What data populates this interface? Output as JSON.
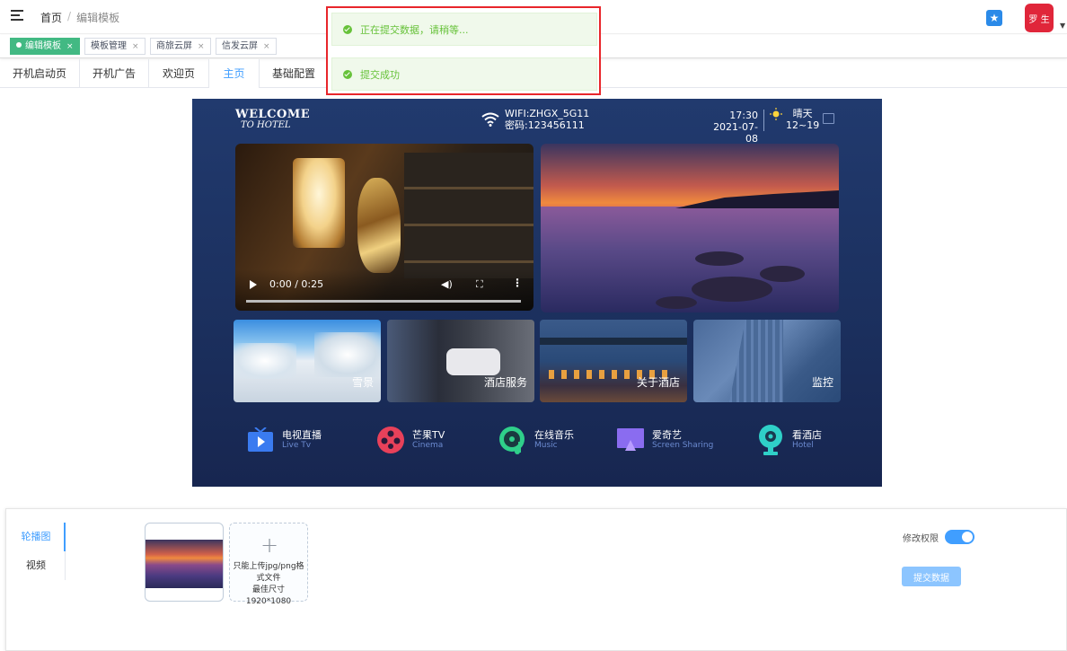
{
  "header": {
    "breadcrumb_home": "首页",
    "breadcrumb_sep": "/",
    "breadcrumb_current": "编辑模板",
    "avatar_text": "罗 生"
  },
  "tags": [
    {
      "label": "编辑模板",
      "active": true
    },
    {
      "label": "模板管理",
      "active": false
    },
    {
      "label": "商旅云屏",
      "active": false
    },
    {
      "label": "信发云屏",
      "active": false
    }
  ],
  "tag_close": "×",
  "page_tabs": [
    "开机启动页",
    "开机广告",
    "欢迎页",
    "主页",
    "基础配置"
  ],
  "active_page_tab": "主页",
  "notifications": [
    {
      "text": "正在提交数据，请稍等..."
    },
    {
      "text": "提交成功"
    }
  ],
  "preview": {
    "welcome_line1": "WELCOME",
    "welcome_line2": "TO HOTEL",
    "wifi_name": "WIFI:ZHGX_5G11",
    "wifi_password": "密码:123456111",
    "time": "17:30",
    "date": "2021-07-08",
    "weather": "晴天",
    "temperature": "12~19",
    "video_time": "0:00 / 0:25",
    "video_progress": 0,
    "tiles": [
      "雪景",
      "酒店服务",
      "关于酒店",
      "监控"
    ],
    "apps": [
      {
        "name": "电视直播",
        "sub": "Live Tv",
        "icon": "tv-icon",
        "color": "#3a7bf0"
      },
      {
        "name": "芒果TV",
        "sub": "Cinema",
        "icon": "film-reel-icon",
        "color": "#e8415a"
      },
      {
        "name": "在线音乐",
        "sub": "Music",
        "icon": "music-disc-icon",
        "color": "#2fcf8a"
      },
      {
        "name": "爱奇艺",
        "sub": "Screen Sharing",
        "icon": "screen-share-icon",
        "color": "#8a6cf0"
      },
      {
        "name": "看酒店",
        "sub": "Hotel",
        "icon": "camera-icon",
        "color": "#2fd0c8"
      }
    ]
  },
  "bottom": {
    "side_tabs": [
      "轮播图",
      "视频"
    ],
    "active_side_tab": "轮播图",
    "upload_plus": "+",
    "upload_tip_1": "只能上传jpg/png格式文件",
    "upload_tip_2": "最佳尺寸1920*1080",
    "permission_label": "修改权限",
    "permission_enabled": true,
    "submit_label": "提交数据"
  },
  "colors": {
    "accent": "#409eff",
    "tag_active": "#42b983",
    "success": "#67c23a",
    "highlight_border": "#e8262b",
    "preview_bg": "#1e3466"
  }
}
